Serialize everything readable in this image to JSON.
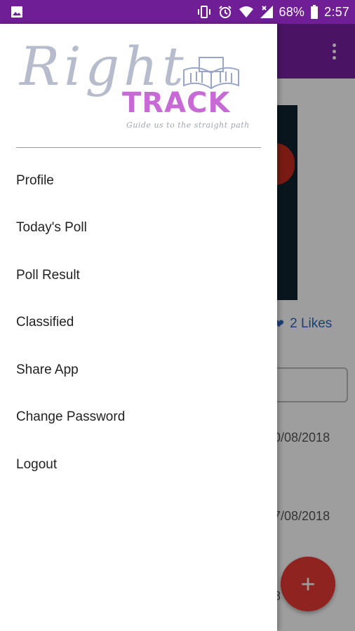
{
  "status_bar": {
    "battery_text": "68%",
    "time": "2:57",
    "icons": [
      "image-icon",
      "vibrate-icon",
      "alarm-icon",
      "wifi-icon",
      "signal-icon",
      "battery-icon"
    ],
    "color": "#6f1e96"
  },
  "background_app": {
    "likes_text": "2 Likes",
    "dates": [
      "0/08/2018",
      "7/08/2018",
      "8"
    ],
    "fab_label": "+",
    "toolbar_color": "#7a1fa2"
  },
  "drawer": {
    "logo": {
      "right": "Right",
      "track": "TRACK",
      "tagline": "Guide us to the straight path"
    },
    "menu": [
      {
        "label": "Profile"
      },
      {
        "label": "Today's Poll"
      },
      {
        "label": "Poll Result"
      },
      {
        "label": "Classified"
      },
      {
        "label": "Share App"
      },
      {
        "label": "Change Password"
      },
      {
        "label": "Logout"
      }
    ]
  }
}
